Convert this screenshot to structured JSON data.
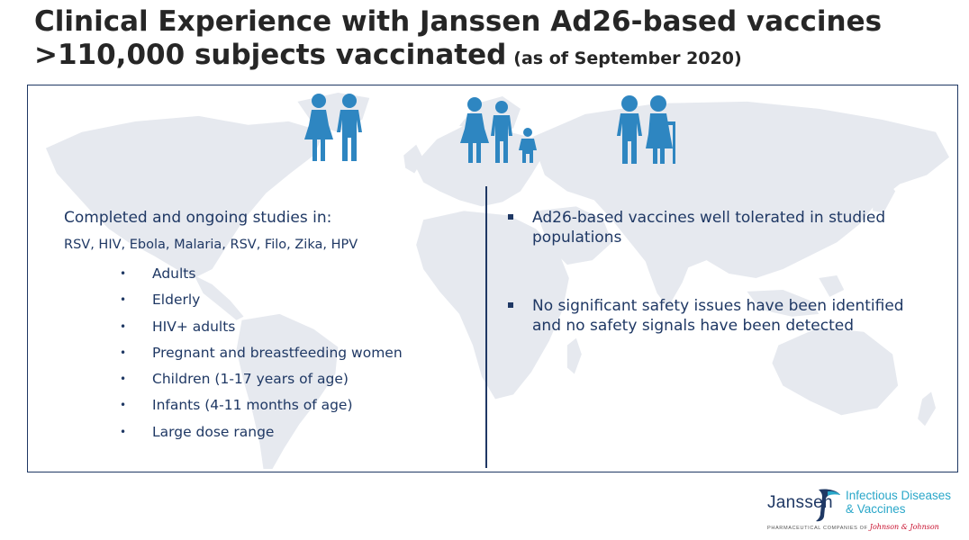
{
  "header": {
    "title_line1": "Clinical Experience with Janssen Ad26-based vaccines",
    "title_line2": ">110,000 subjects vaccinated",
    "title_note": "(as of September 2020)"
  },
  "icons": {
    "group1": "adult-couple-icon",
    "group2": "family-with-child-icon",
    "group3": "elderly-couple-icon",
    "color": "#2e86c1"
  },
  "studies": {
    "heading": "Completed and ongoing studies in:",
    "diseases": "RSV, HIV, Ebola, Malaria, RSV, Filo, Zika, HPV",
    "bullet": "•",
    "populations": [
      "Adults",
      "Elderly",
      "HIV+ adults",
      "Pregnant and breastfeeding women",
      "Children (1-17 years of age)",
      "Infants (4-11 months of age)",
      "Large dose range"
    ]
  },
  "key_points": [
    "Ad26-based vaccines well tolerated in studied populations",
    "No significant safety issues have been identified and no safety signals have been detected"
  ],
  "logo": {
    "brand": "Janssen",
    "unit_line1": "Infectious Diseases",
    "unit_line2": "& Vaccines",
    "tagline_prefix": "PHARMACEUTICAL COMPANIES OF",
    "tagline_company": "Johnson & Johnson"
  },
  "colors": {
    "title": "#262626",
    "text_navy": "#1f3864",
    "map_gray": "#e6e9ef",
    "brand_teal": "#2aa7c9"
  }
}
